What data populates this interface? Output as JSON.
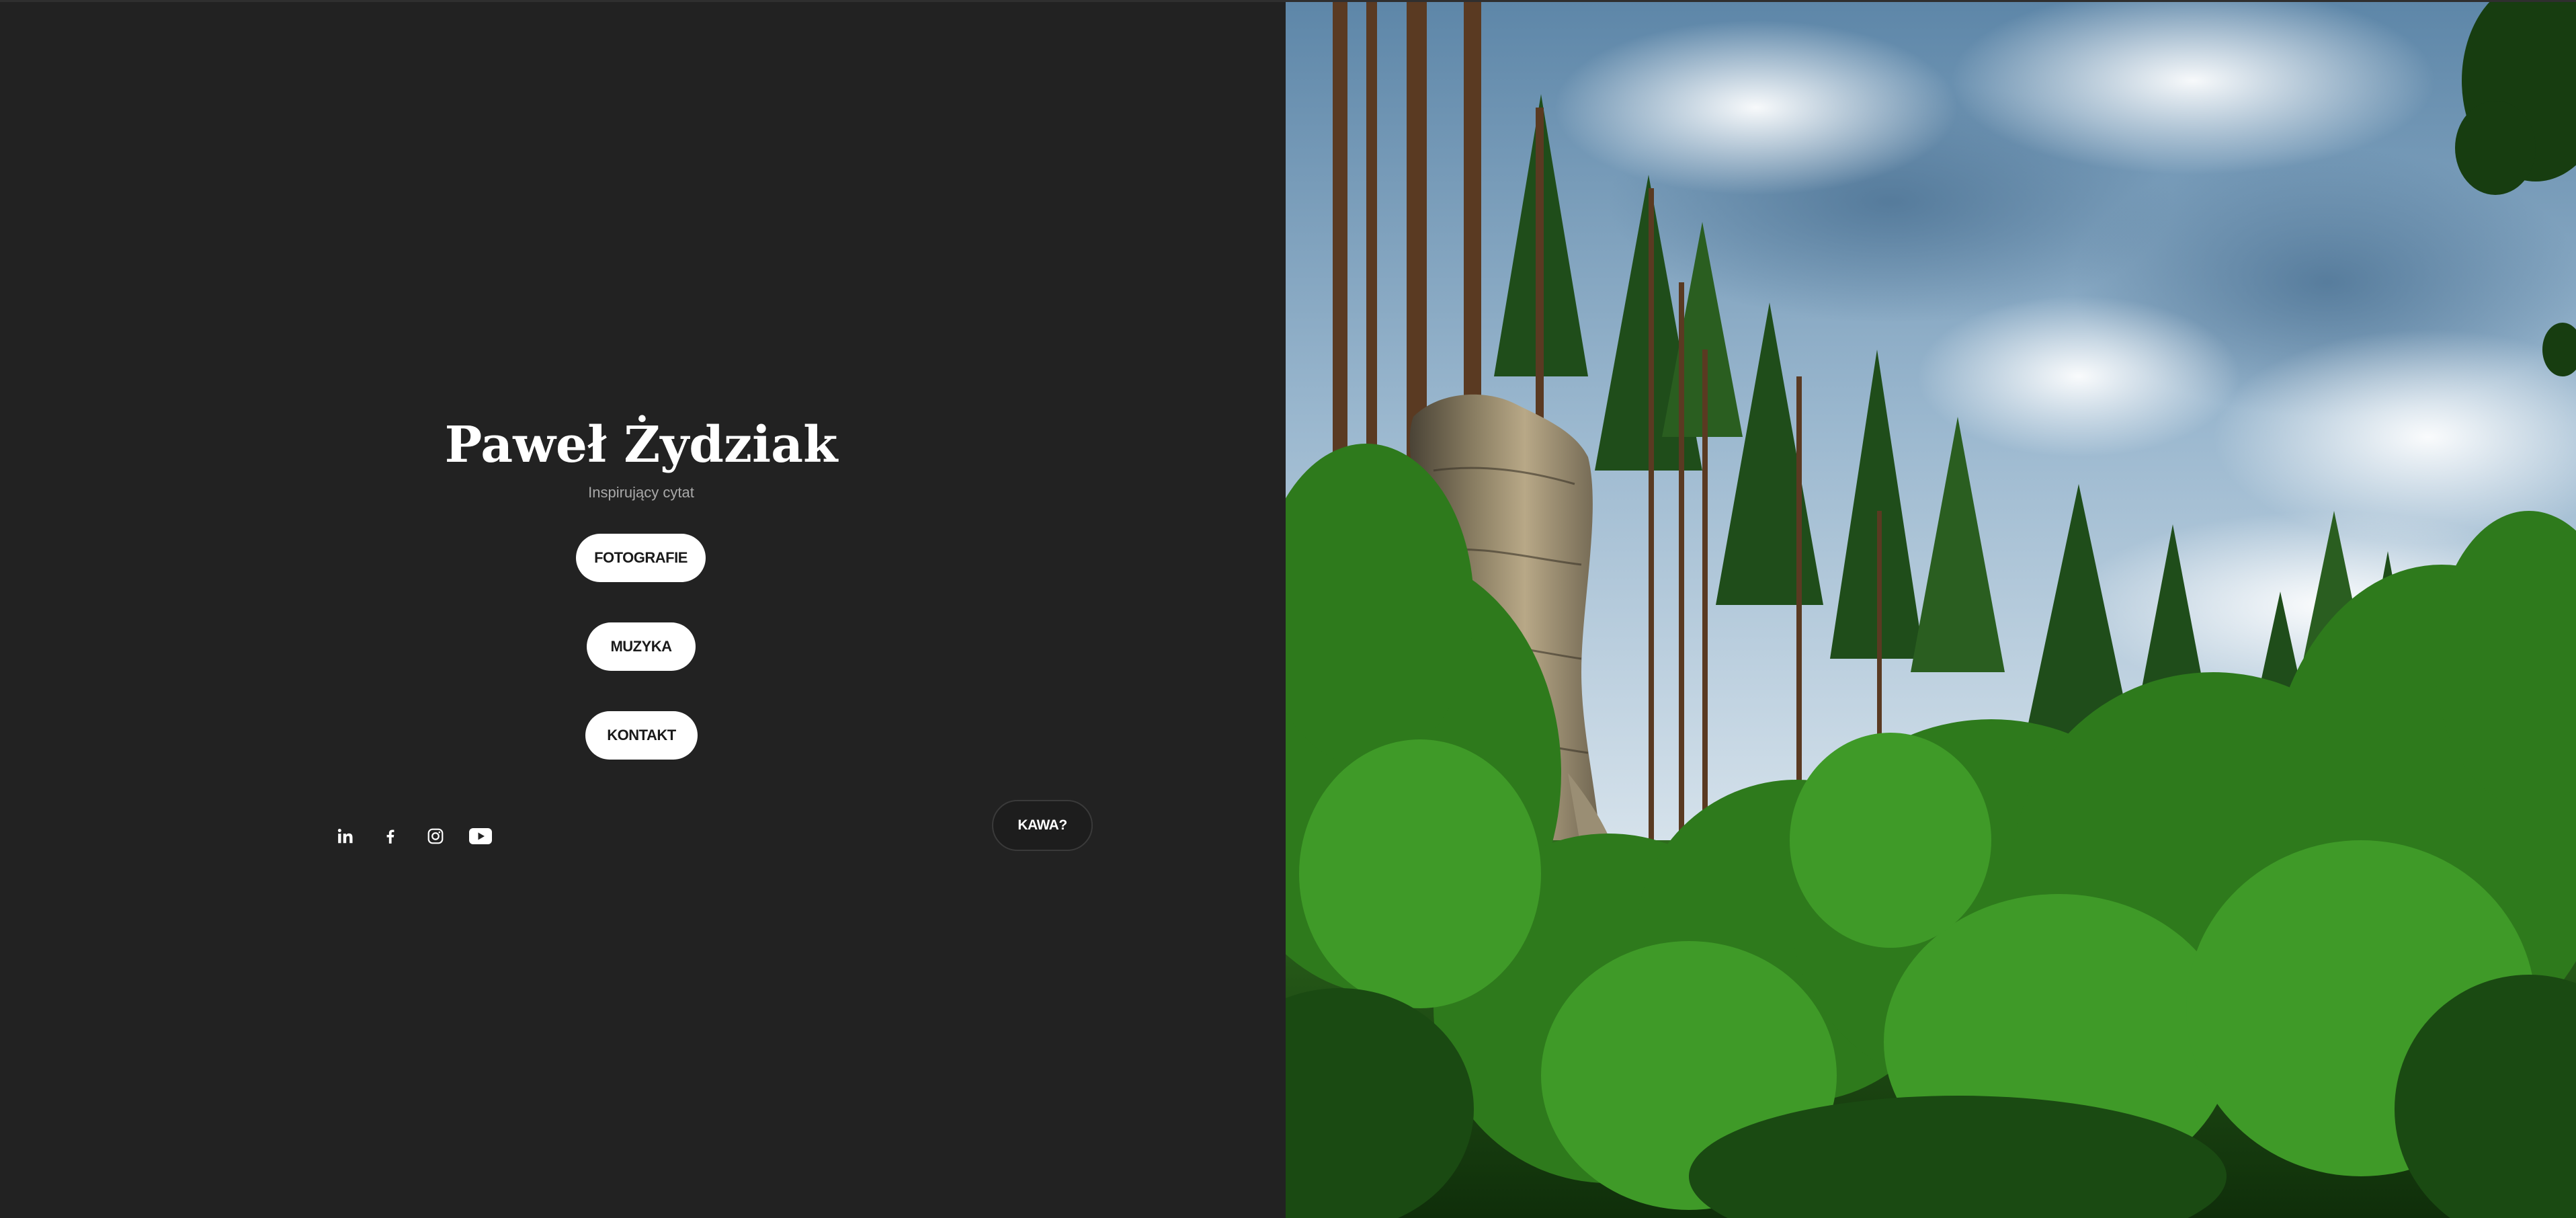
{
  "header": {
    "title": "Paweł Żydziak",
    "subtitle": "Inspirujący cytat"
  },
  "nav": {
    "items": [
      {
        "label": "FOTOGRAFIE"
      },
      {
        "label": "MUZYKA"
      },
      {
        "label": "KONTAKT"
      }
    ]
  },
  "coffee_button": {
    "label": "KAWA?"
  },
  "social": [
    {
      "icon": "linkedin-icon"
    },
    {
      "icon": "facebook-icon"
    },
    {
      "icon": "instagram-icon"
    },
    {
      "icon": "youtube-icon"
    }
  ],
  "hero_image": {
    "subject": "sandstone rock tower in a pine forest under a cloudy blue sky"
  },
  "colors": {
    "background": "#222222",
    "button_bg": "#ffffff",
    "button_text": "#1a1a1a",
    "subtitle": "#a9a9a9"
  }
}
